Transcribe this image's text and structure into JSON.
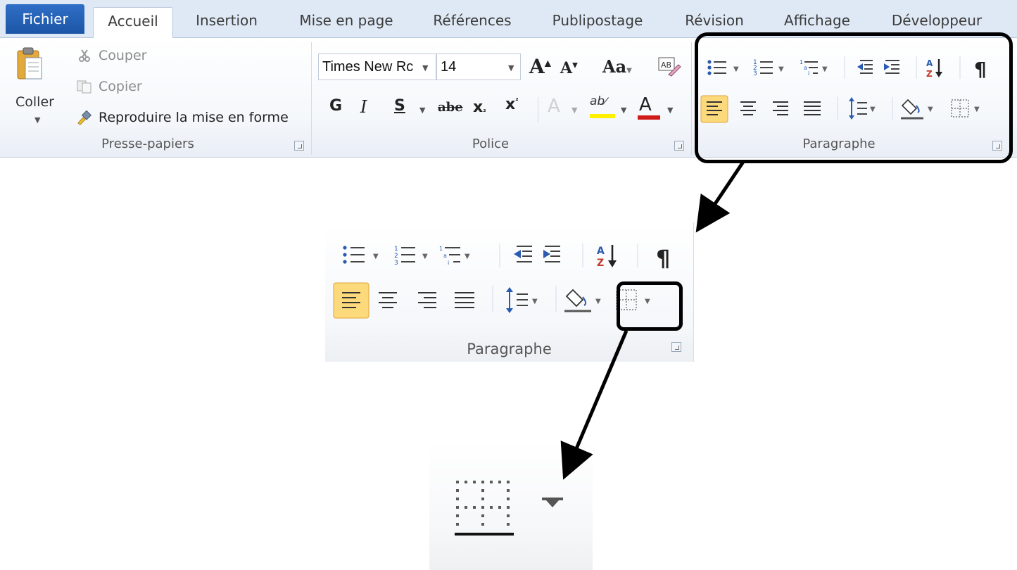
{
  "tabs": [
    {
      "label": "Fichier"
    },
    {
      "label": "Accueil"
    },
    {
      "label": "Insertion"
    },
    {
      "label": "Mise en page"
    },
    {
      "label": "Références"
    },
    {
      "label": "Publipostage"
    },
    {
      "label": "Révision"
    },
    {
      "label": "Affichage"
    },
    {
      "label": "Développeur"
    }
  ],
  "clipboard": {
    "paste_label": "Coller",
    "cut_label": "Couper",
    "copy_label": "Copier",
    "format_painter_label": "Reproduire la mise en forme",
    "group_label": "Presse-papiers"
  },
  "font": {
    "font_name": "Times New Rc",
    "font_size": "14",
    "group_label": "Police"
  },
  "paragraph": {
    "group_label": "Paragraphe",
    "align_left_active": true
  },
  "zoom": {
    "group_label": "Paragraphe"
  },
  "colors": {
    "highlight_active": "#fcd97a",
    "highlight_border": "#e0a53a",
    "callout": "#000000",
    "file_tab": "#2a66bd",
    "font_color_red": "#d01a1a",
    "text_highlight_yellow": "#ffef00"
  }
}
